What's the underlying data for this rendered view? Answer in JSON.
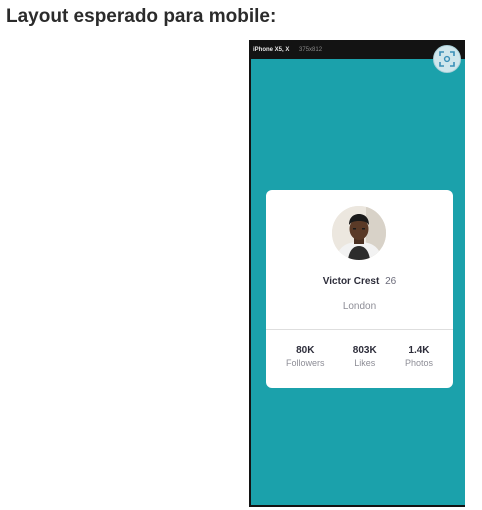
{
  "heading": "Layout esperado para mobile:",
  "device": {
    "model": "iPhone X5, X",
    "resolution": "375x812",
    "screen_color": "#1ba1ab"
  },
  "toolbar": {
    "capture_icon": "screenshot-capture-icon"
  },
  "profile": {
    "name": "Victor Crest",
    "age": "26",
    "city": "London",
    "avatar_icon": "profile-photo"
  },
  "stats": [
    {
      "value": "80K",
      "label": "Followers"
    },
    {
      "value": "803K",
      "label": "Likes"
    },
    {
      "value": "1.4K",
      "label": "Photos"
    }
  ]
}
